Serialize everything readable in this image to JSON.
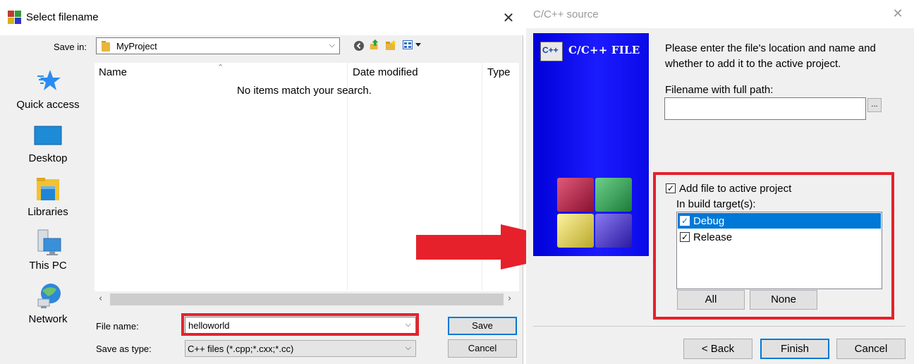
{
  "save_dialog": {
    "title": "Select filename",
    "save_in_label": "Save in:",
    "save_in_value": "MyProject",
    "places": [
      "Quick access",
      "Desktop",
      "Libraries",
      "This PC",
      "Network"
    ],
    "columns": [
      "Name",
      "Date modified",
      "Type"
    ],
    "empty_message": "No items match your search.",
    "file_name_label": "File name:",
    "file_name_value": "helloworld",
    "save_type_label": "Save as type:",
    "save_type_value": "C++ files (*.cpp;*.cxx;*.cc)",
    "save_button": "Save",
    "cancel_button": "Cancel"
  },
  "wizard": {
    "title": "C/C++ source",
    "banner_text": "C/C++ FILE",
    "banner_badge": "C++",
    "intro": "Please enter the file's location and name and whether to add it to the active project.",
    "filename_label": "Filename with full path:",
    "filename_value": "",
    "browse_button": "...",
    "add_to_project_label": "Add file to active project",
    "add_to_project_checked": true,
    "build_targets_label": "In build target(s):",
    "targets": [
      {
        "label": "Debug",
        "checked": true,
        "selected": true
      },
      {
        "label": "Release",
        "checked": true,
        "selected": false
      }
    ],
    "all_button": "All",
    "none_button": "None",
    "back_button": "< Back",
    "finish_button": "Finish",
    "cancel_button": "Cancel"
  },
  "colors": {
    "highlight_red": "#e6212b",
    "selection_blue": "#0078d7",
    "banner_blue": "#1b1bff"
  }
}
